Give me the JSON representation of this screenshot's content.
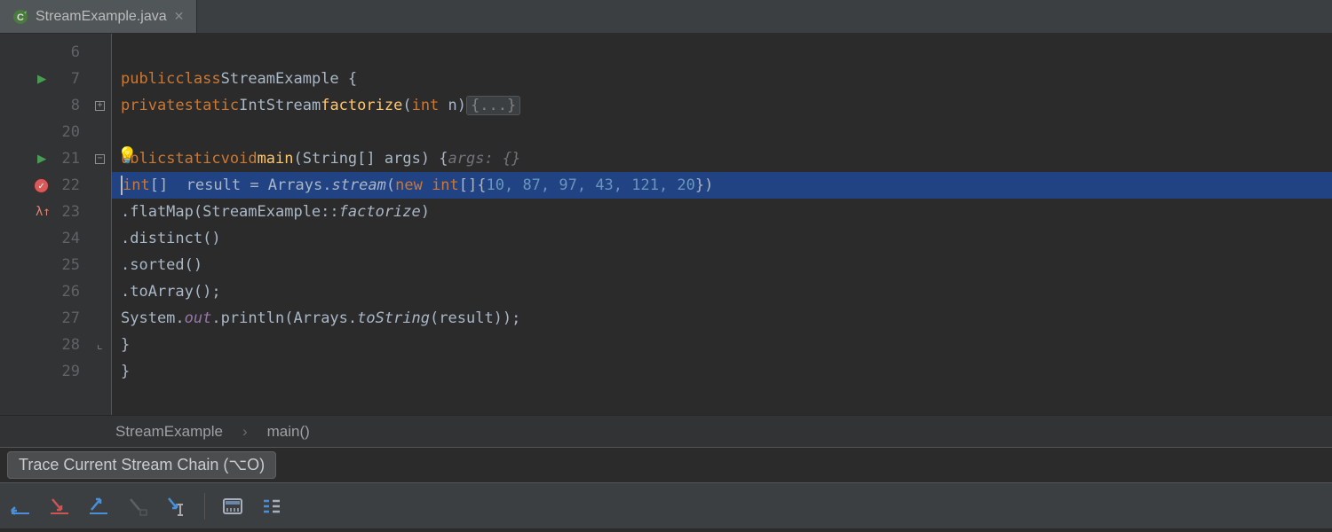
{
  "tab": {
    "filename": "StreamExample.java"
  },
  "gutter": {
    "lines": [
      "6",
      "7",
      "8",
      "20",
      "21",
      "22",
      "23",
      "24",
      "25",
      "26",
      "27",
      "28",
      "29"
    ]
  },
  "code": {
    "l7_kw1": "public",
    "l7_kw2": "class",
    "l7_cls": "StreamExample",
    "l7_brace": " {",
    "l8_kw1": "private",
    "l8_kw2": "static",
    "l8_ret": "IntStream",
    "l8_name": "factorize",
    "l8_sig": "(",
    "l8_kw3": "int",
    "l8_param": " n)",
    "l8_fold": "{...}",
    "l21_kw1": "ublic",
    "l21_kw2": "static",
    "l21_kw3": "void",
    "l21_name": "main",
    "l21_sig": "(String[] args) {",
    "l21_hint": "args: {}",
    "l22_kw1": "int",
    "l22_arr": "[]",
    "l22_var": "  result = Arrays.",
    "l22_stream": "stream",
    "l22_op": "(",
    "l22_kw2": "new",
    "l22_kw3": " int",
    "l22_brk": "[]{",
    "l22_nums": "10, 87, 97, 43, 121, 20",
    "l22_end": "})",
    "l23_txt": ".flatMap(StreamExample::",
    "l23_fac": "factorize",
    "l23_end": ")",
    "l24_txt": ".distinct()",
    "l25_txt": ".sorted()",
    "l26_txt": ".toArray();",
    "l27_a": "System.",
    "l27_out": "out",
    "l27_b": ".println(Arrays.",
    "l27_ts": "toString",
    "l27_c": "(result));",
    "l28_txt": "}",
    "l29_txt": "}"
  },
  "crumbs": {
    "class": "StreamExample",
    "method": "main()"
  },
  "tooltip": {
    "text": "Trace Current Stream Chain (⌥O)"
  }
}
